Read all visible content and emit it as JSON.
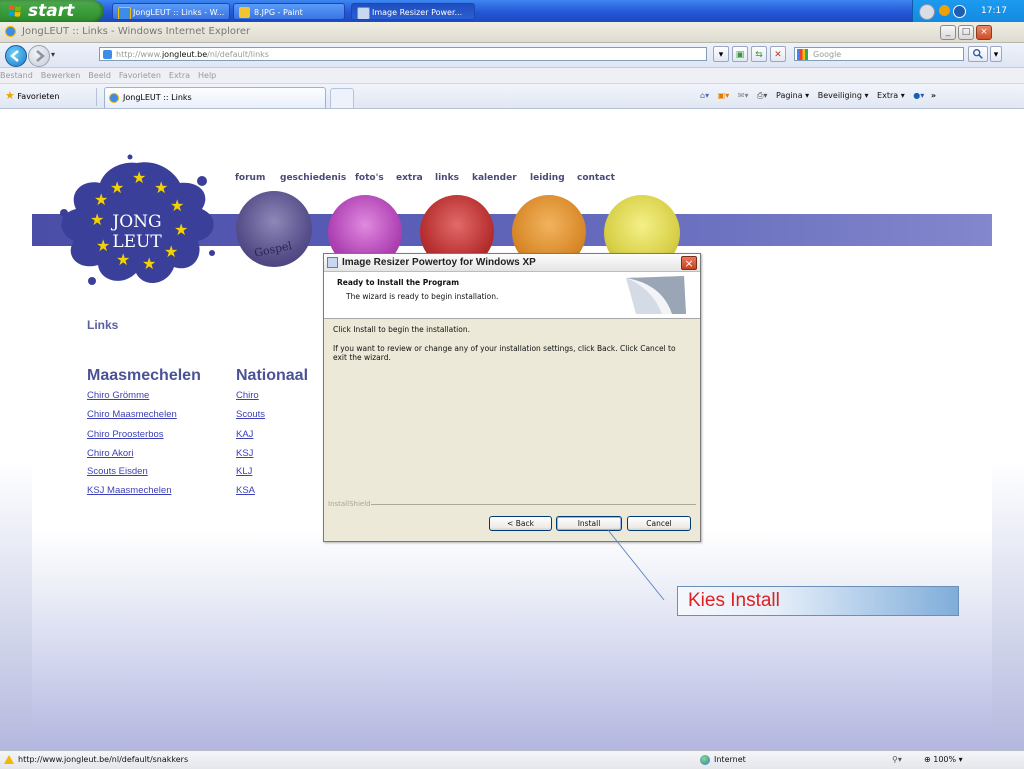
{
  "taskbar": {
    "start_label": "start",
    "buttons": [
      {
        "label": "JongLEUT :: Links - W..."
      },
      {
        "label": "8.JPG - Paint"
      },
      {
        "label": "Image Resizer Power..."
      }
    ],
    "clock": "17:17"
  },
  "browser": {
    "window_title": "JongLEUT :: Links - Windows Internet Explorer",
    "address_prefix": "http://www.",
    "address_domain": "jongleut.be",
    "address_path": "/nl/default/links",
    "search_placeholder": "Google",
    "menu": [
      "Bestand",
      "Bewerken",
      "Beeld",
      "Favorieten",
      "Extra",
      "Help"
    ],
    "favorites_label": "Favorieten",
    "tab_label": "JongLEUT :: Links",
    "toolbar_right": [
      "Pagina",
      "Beveiliging",
      "Extra"
    ],
    "status_url": "http://www.jongleut.be/nl/default/snakkers",
    "status_zone": "Internet",
    "zoom": "100%"
  },
  "site": {
    "logo_line1": "JONG",
    "logo_line2": "LEUT",
    "nav": [
      "forum",
      "geschiedenis",
      "foto's",
      "extra",
      "links",
      "kalender",
      "leiding",
      "contact"
    ],
    "gospel_label": "Gospel",
    "links_heading": "Links",
    "col1_heading": "Maasmechelen",
    "col1_links": [
      "Chiro Grömme",
      "Chiro Maasmechelen",
      "Chiro Proosterbos",
      "Chiro Akori",
      "Scouts Eisden",
      "KSJ Maasmechelen"
    ],
    "col2_heading": "Nationaal",
    "col2_links": [
      "Chiro",
      "Scouts",
      "KAJ",
      "KSJ",
      "KLJ",
      "KSA"
    ]
  },
  "dialog": {
    "title": "Image Resizer Powertoy for Windows XP",
    "heading": "Ready to Install the Program",
    "subheading": "The wizard is ready to begin installation.",
    "line1": "Click Install to begin the installation.",
    "line2": "If you want to review or change any of your installation settings, click Back. Click Cancel to exit the wizard.",
    "brand": "InstallShield",
    "back_label": "< Back",
    "install_label": "Install",
    "cancel_label": "Cancel"
  },
  "annotation": {
    "text": "Kies Install",
    "color": "#e02020"
  },
  "colors": {
    "taskbar_blue": "#2457d6",
    "start_green": "#379a37",
    "band_purple": "#5a5eb6",
    "site_link": "#3b3fb8"
  }
}
